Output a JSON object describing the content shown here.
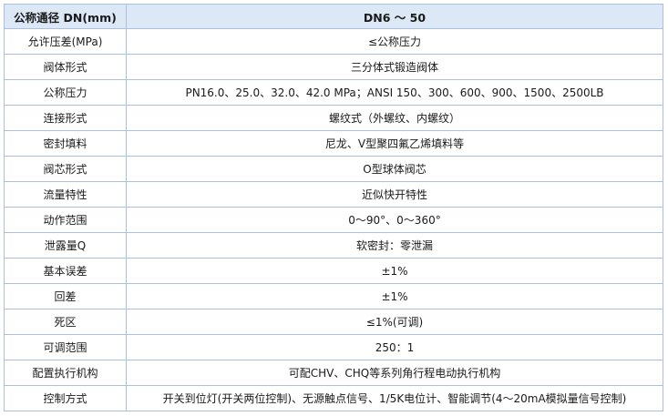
{
  "table": {
    "header": {
      "label": "公称通径 DN(mm)",
      "value": "DN6 ～ 50"
    },
    "rows": [
      {
        "label": "允许压差(MPa)",
        "value": "≤公称压力"
      },
      {
        "label": "阀体形式",
        "value": "三分体式锻造阀体"
      },
      {
        "label": "公称压力",
        "value": "PN16.0、25.0、32.0、42.0 MPa；ANSI 150、300、600、900、1500、2500LB"
      },
      {
        "label": "连接形式",
        "value": "螺纹式（外螺纹、内螺纹）"
      },
      {
        "label": "密封填料",
        "value": "尼龙、V型聚四氟乙烯填料等"
      },
      {
        "label": "阀芯形式",
        "value": "O型球体阀芯"
      },
      {
        "label": "流量特性",
        "value": "近似快开特性"
      },
      {
        "label": "动作范围",
        "value": "0～90°、0～360°"
      },
      {
        "label": "泄露量Q",
        "value": "软密封：零泄漏"
      },
      {
        "label": "基本误差",
        "value": "±1%"
      },
      {
        "label": "回差",
        "value": "±1%"
      },
      {
        "label": "死区",
        "value": "≤1%(可调)"
      },
      {
        "label": "可调范围",
        "value": "250：1"
      },
      {
        "label": "配置执行机构",
        "value": "可配CHV、CHQ等系列角行程电动执行机构"
      },
      {
        "label": "控制方式",
        "value": "开关到位灯(开关两位控制)、无源触点信号、1/5K电位计、智能调节(4～20mA模拟量信号控制)"
      }
    ]
  }
}
